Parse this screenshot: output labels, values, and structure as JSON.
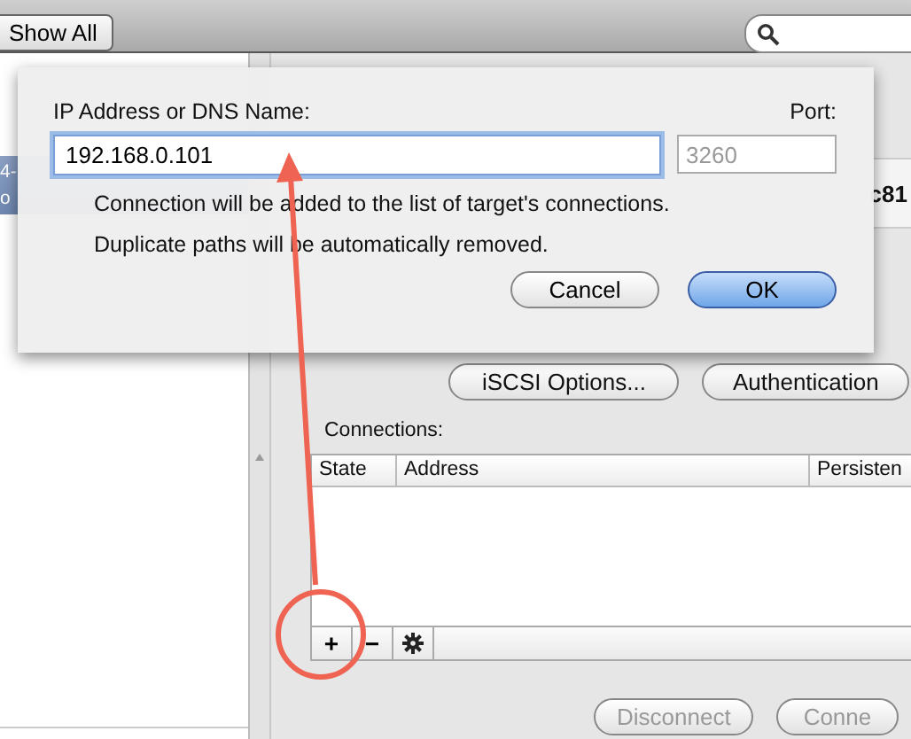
{
  "toolbar": {
    "show_all": "Show All"
  },
  "sidebar": {
    "items": [
      {
        "title": "4-",
        "subtitle": "o",
        "selected": true
      }
    ]
  },
  "target": {
    "name": "c81"
  },
  "actions": [
    "iSCSI Options...",
    "Authentication"
  ],
  "connections": {
    "label": "Connections:",
    "columns": [
      "State",
      "Address",
      "Persisten"
    ],
    "add": "+",
    "remove": "−"
  },
  "footer_buttons": [
    {
      "label": "Disconnect",
      "disabled": true
    },
    {
      "label": "Conne",
      "disabled": true
    }
  ],
  "dialog": {
    "address_label": "IP Address or DNS Name:",
    "address_value": "192.168.0.101",
    "port_label": "Port:",
    "port_placeholder": "3260",
    "notes": [
      "Connection will be added to the list of target's connections.",
      "Duplicate paths will be automatically removed."
    ],
    "buttons": [
      {
        "label": "Cancel",
        "default": false
      },
      {
        "label": "OK",
        "default": true
      }
    ]
  }
}
